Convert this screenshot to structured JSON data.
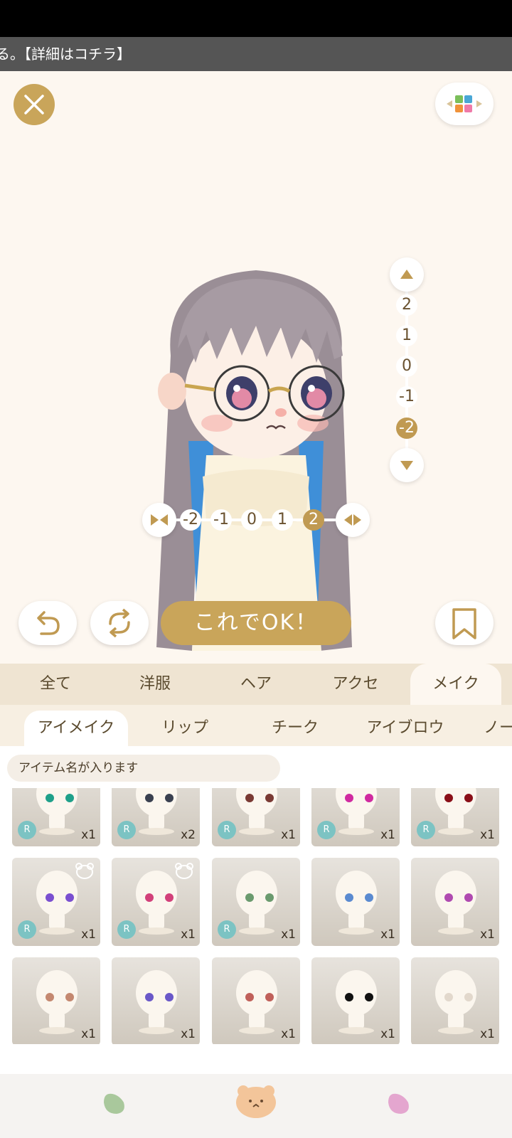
{
  "ticker": {
    "text": "る。【詳細はコチラ】"
  },
  "stage": {
    "ok_label": "これでOK！",
    "vertical_slider": {
      "ticks": [
        "2",
        "1",
        "0",
        "-1",
        "-2"
      ],
      "selected": "-2"
    },
    "horizontal_slider": {
      "ticks": [
        "-2",
        "-1",
        "0",
        "1",
        "2"
      ],
      "selected": "2"
    }
  },
  "categories": [
    {
      "label": "全て"
    },
    {
      "label": "洋服"
    },
    {
      "label": "ヘア"
    },
    {
      "label": "アクセ"
    },
    {
      "label": "メイク",
      "active": true
    }
  ],
  "subcategories": [
    {
      "label": "アイメイク",
      "active": true
    },
    {
      "label": "リップ"
    },
    {
      "label": "チーク"
    },
    {
      "label": "アイブロウ"
    },
    {
      "label": "ノー"
    }
  ],
  "item_name_placeholder": "アイテム名が入ります",
  "items": [
    {
      "qty": "x1",
      "rare": "R",
      "eye_color": "#1fa08a"
    },
    {
      "qty": "x2",
      "rare": "R",
      "eye_color": "#3a4050"
    },
    {
      "qty": "x1",
      "rare": "R",
      "eye_color": "#7a3a34"
    },
    {
      "qty": "x1",
      "rare": "R",
      "eye_color": "#d02aa0"
    },
    {
      "qty": "x1",
      "rare": "R",
      "eye_color": "#8a0f18"
    },
    {
      "qty": "x1",
      "rare": "R",
      "eye_color": "#7a4fd0",
      "bear": true
    },
    {
      "qty": "x1",
      "rare": "R",
      "eye_color": "#d2407a",
      "bear": true
    },
    {
      "qty": "x1",
      "rare": "R",
      "eye_color": "#6a9a6e"
    },
    {
      "qty": "x1",
      "eye_color": "#5a8ad0"
    },
    {
      "qty": "x1",
      "eye_color": "#b04ab0"
    },
    {
      "qty": "x1",
      "eye_color": "#c48870"
    },
    {
      "qty": "x1",
      "eye_color": "#6a58c8"
    },
    {
      "qty": "x1",
      "eye_color": "#c0605a"
    },
    {
      "qty": "x1",
      "eye_color": "#111111"
    },
    {
      "qty": "x1",
      "eye_color": "#e2d8cc"
    }
  ],
  "colors": {
    "accent": "#c9a55a",
    "stage_bg": "#fdf7f0",
    "tab_bg": "#efe4d2"
  },
  "bottom_nav": [
    "green-jellybean-icon",
    "bear-face-icon",
    "pink-jellybean-icon"
  ]
}
